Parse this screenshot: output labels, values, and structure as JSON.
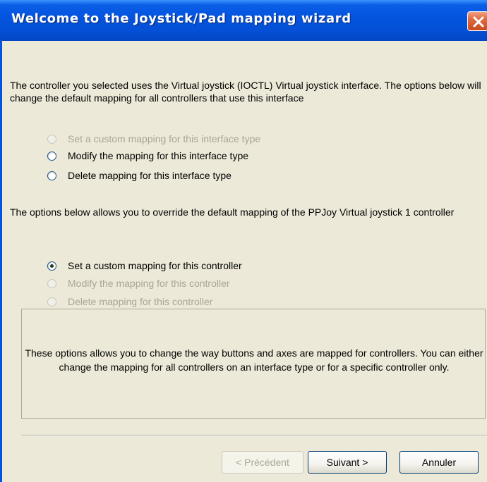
{
  "window": {
    "title": "Welcome to the Joystick/Pad mapping wizard"
  },
  "intro": {
    "text": "The controller you selected uses the Virtual joystick (IOCTL) Virtual joystick interface. The options below will change the default mapping for all controllers that use this interface"
  },
  "interface_options": [
    {
      "label": "Set a custom mapping for this interface type",
      "checked": false,
      "enabled": false
    },
    {
      "label": "Modify the mapping for this interface type",
      "checked": false,
      "enabled": true
    },
    {
      "label": "Delete mapping for this interface type",
      "checked": false,
      "enabled": true
    }
  ],
  "controller_intro": {
    "text": "The options below allows you to override the default mapping of the PPJoy Virtual joystick 1 controller"
  },
  "controller_options": [
    {
      "label": "Set a custom mapping for this controller",
      "checked": true,
      "enabled": true
    },
    {
      "label": "Modify the mapping for this controller",
      "checked": false,
      "enabled": false
    },
    {
      "label": "Delete mapping for this controller",
      "checked": false,
      "enabled": false
    }
  ],
  "info": {
    "text": "These options allows you to change the way buttons and axes are mapped for controllers. You can either change the mapping for all controllers on an interface type or for a specific controller only."
  },
  "buttons": {
    "back": "< Précédent",
    "next": "Suivant >",
    "cancel": "Annuler"
  },
  "colors": {
    "titlebar": "#0454e0",
    "dialog_background": "#ece9d8",
    "disabled_text": "#a8a597"
  }
}
